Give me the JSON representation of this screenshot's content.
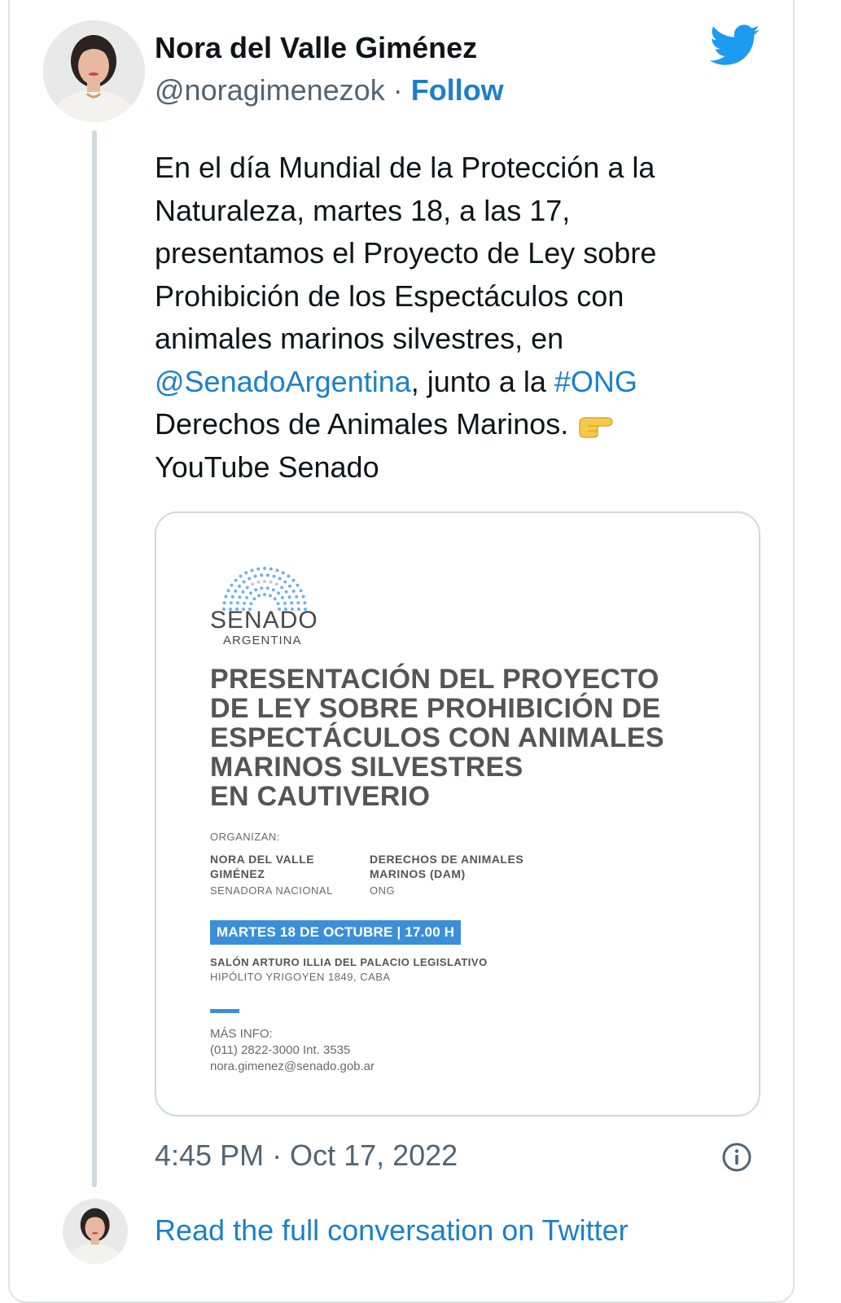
{
  "tweet": {
    "author": {
      "name": "Nora del Valle Giménez",
      "handle": "@noragimenezok",
      "separator": " · ",
      "follow_label": "Follow"
    },
    "text": {
      "line1": "En el día Mundial de la Protección a la",
      "line2": "Naturaleza, martes 18, a las 17,",
      "line3": "presentamos el Proyecto de Ley sobre",
      "line4": "Prohibición de los Espectáculos con",
      "line5": "animales marinos silvestres, en",
      "mention": "@SenadoArgentina",
      "mid": ", junto a la ",
      "hashtag": "#ONG",
      "line7": "Derechos de Animales Marinos.",
      "line8": "YouTube Senado"
    },
    "emoji": "backhand-index-pointing-right",
    "timestamp": "4:45 PM · Oct 17, 2022",
    "read_full": "Read the full conversation on Twitter"
  },
  "poster": {
    "logo_word": "SENADO",
    "logo_sub": "ARGENTINA",
    "title_lines": [
      "PRESENTACIÓN DEL PROYECTO",
      "DE LEY SOBRE PROHIBICIÓN DE",
      "ESPECTÁCULOS CON ANIMALES",
      "MARINOS SILVESTRES",
      "EN CAUTIVERIO"
    ],
    "organizers_label": "ORGANIZAN:",
    "organizer1": {
      "name_line1": "NORA DEL VALLE",
      "name_line2": "GIMÉNEZ",
      "role": "SENADORA NACIONAL"
    },
    "organizer2": {
      "name_line1": "DERECHOS DE ANIMALES",
      "name_line2": "MARINOS (DAM)",
      "role": "ONG"
    },
    "date": "MARTES 18 DE OCTUBRE | 17.00 H",
    "venue": "SALÓN ARTURO ILLIA DEL PALACIO LEGISLATIVO",
    "address": "HIPÓLITO YRIGOYEN 1849, CABA",
    "more_info_label": "MÁS INFO:",
    "phone": "(011) 2822-3000 Int. 3535",
    "email": "nora.gimenez@senado.gob.ar"
  },
  "colors": {
    "link": "#1d7fcc",
    "twitter_blue": "#1d9bf0",
    "muted": "#536471",
    "poster_accent": "#3b8fd8"
  },
  "icons": [
    "twitter-bird-icon",
    "info-icon"
  ]
}
